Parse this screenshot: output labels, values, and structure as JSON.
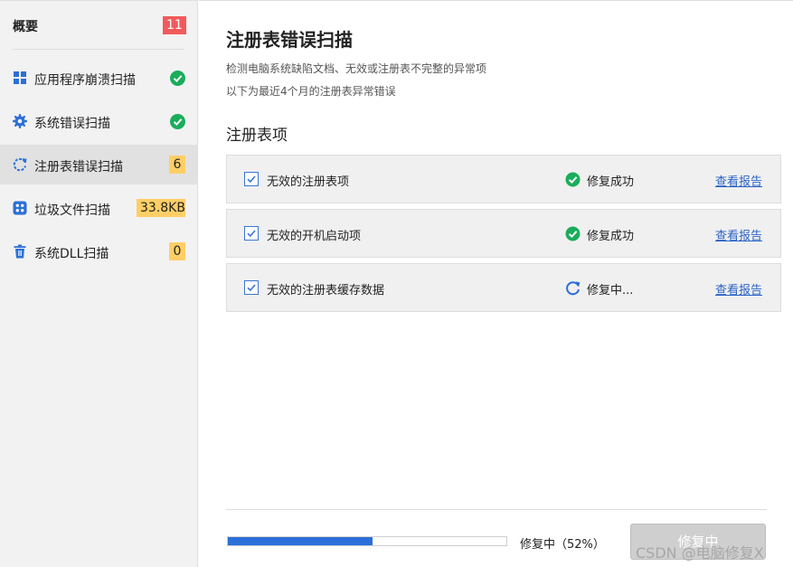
{
  "colors": {
    "accent": "#2b6fd9",
    "success": "#1aad5b",
    "overview_badge": "#f25a5a",
    "count_badge": "#ffcf66",
    "link": "#2a63c7"
  },
  "sidebar": {
    "overview": {
      "label": "概要",
      "count": "11"
    },
    "items": [
      {
        "label": "应用程序崩溃扫描",
        "icon": "grid-app-icon",
        "status": "check-circle-icon"
      },
      {
        "label": "系统错误扫描",
        "icon": "gear-icon",
        "status": "check-circle-icon"
      },
      {
        "label": "注册表错误扫描",
        "icon": "refresh-icon",
        "badge": "6",
        "active": true
      },
      {
        "label": "垃圾文件扫描",
        "icon": "junk-file-icon",
        "badge": "33.8KB"
      },
      {
        "label": "系统DLL扫描",
        "icon": "trash-icon",
        "badge": "0"
      }
    ]
  },
  "main": {
    "title": "注册表错误扫描",
    "description_1": "检测电脑系统缺陷文档、无效或注册表不完整的异常项",
    "description_2": "以下为最近4个月的注册表异常错误",
    "section_title": "注册表项",
    "rows": [
      {
        "name": "无效的注册表项",
        "status": "修复成功",
        "status_icon": "check-circle-icon",
        "link": "查看报告",
        "checked": true
      },
      {
        "name": "无效的开机启动项",
        "status": "修复成功",
        "status_icon": "check-circle-icon",
        "link": "查看报告",
        "checked": true
      },
      {
        "name": "无效的注册表缓存数据",
        "status": "修复中...",
        "status_icon": "spinner-icon",
        "link": "查看报告",
        "checked": true
      }
    ]
  },
  "footer": {
    "progress_percent": 52,
    "progress_text": "修复中（52%）",
    "button_label": "修复中",
    "watermark": "CSDN @电脑修复X"
  }
}
